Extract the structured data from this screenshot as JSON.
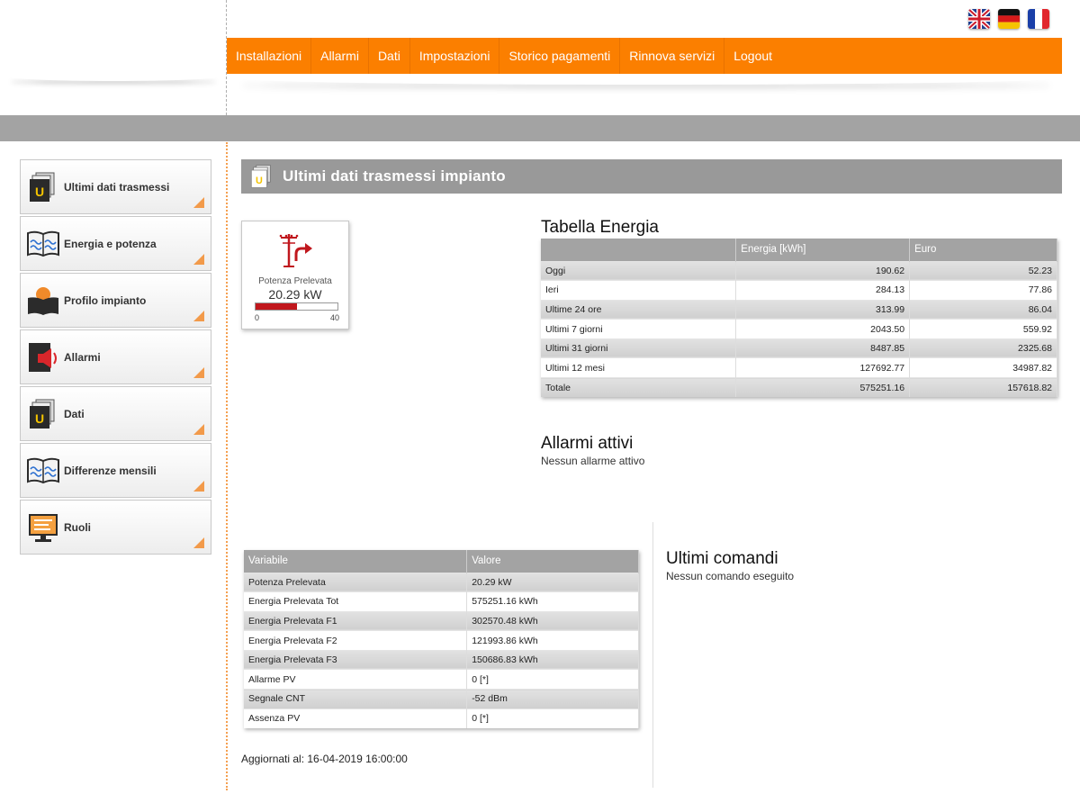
{
  "languages": [
    {
      "name": "English",
      "icon": "uk-flag-icon"
    },
    {
      "name": "Deutsch",
      "icon": "german-flag-icon"
    },
    {
      "name": "Français",
      "icon": "french-flag-icon"
    }
  ],
  "nav": {
    "items": [
      "Installazioni",
      "Allarmi",
      "Dati",
      "Impostazioni",
      "Storico pagamenti",
      "Rinnova servizi",
      "Logout"
    ]
  },
  "sidebar": {
    "items": [
      {
        "label": "Ultimi dati trasmessi",
        "icon": "data-folder-icon"
      },
      {
        "label": "Energia e potenza",
        "icon": "chart-book-icon"
      },
      {
        "label": "Profilo impianto",
        "icon": "reader-profile-icon"
      },
      {
        "label": "Allarmi",
        "icon": "alarm-speaker-icon"
      },
      {
        "label": "Dati",
        "icon": "data-folder-icon"
      },
      {
        "label": "Differenze mensili",
        "icon": "chart-book-icon"
      },
      {
        "label": "Ruoli",
        "icon": "monitor-roles-icon"
      }
    ]
  },
  "page": {
    "title": "Ultimi dati trasmessi impianto",
    "title_icon": "data-folder-icon"
  },
  "gauge": {
    "label": "Potenza Prelevata",
    "value": "20.29 kW",
    "min": "0",
    "max": "40",
    "fill_fraction": 0.507,
    "icon": "power-pole-arrow-icon",
    "accent_color": "#c0171d"
  },
  "energia": {
    "title": "Tabella Energia",
    "headers": [
      "",
      "Energia [kWh]",
      "Euro"
    ],
    "rows": [
      [
        "Oggi",
        "190.62",
        "52.23"
      ],
      [
        "Ieri",
        "284.13",
        "77.86"
      ],
      [
        "Ultime 24 ore",
        "313.99",
        "86.04"
      ],
      [
        "Ultimi 7 giorni",
        "2043.50",
        "559.92"
      ],
      [
        "Ultimi 31 giorni",
        "8487.85",
        "2325.68"
      ],
      [
        "Ultimi 12 mesi",
        "127692.77",
        "34987.82"
      ],
      [
        "Totale",
        "575251.16",
        "157618.82"
      ]
    ]
  },
  "allarmi": {
    "title": "Allarmi attivi",
    "message": "Nessun allarme attivo"
  },
  "variabili": {
    "headers": [
      "Variabile",
      "Valore"
    ],
    "rows": [
      [
        "Potenza Prelevata",
        "20.29 kW"
      ],
      [
        "Energia Prelevata Tot",
        "575251.16 kWh"
      ],
      [
        "Energia Prelevata F1",
        "302570.48 kWh"
      ],
      [
        "Energia Prelevata F2",
        "121993.86 kWh"
      ],
      [
        "Energia Prelevata F3",
        "150686.83 kWh"
      ],
      [
        "Allarme PV",
        "0 [*]"
      ],
      [
        "Segnale CNT",
        "-52 dBm"
      ],
      [
        "Assenza PV",
        "0 [*]"
      ]
    ]
  },
  "comandi": {
    "title": "Ultimi comandi",
    "message": "Nessun comando eseguito"
  },
  "footer": {
    "updated": "Aggiornati al: 16-04-2019 16:00:00"
  },
  "colors": {
    "nav_bg": "#fb7f00",
    "band_gray": "#a3a3a3",
    "corner_accent": "#f29a4a"
  }
}
